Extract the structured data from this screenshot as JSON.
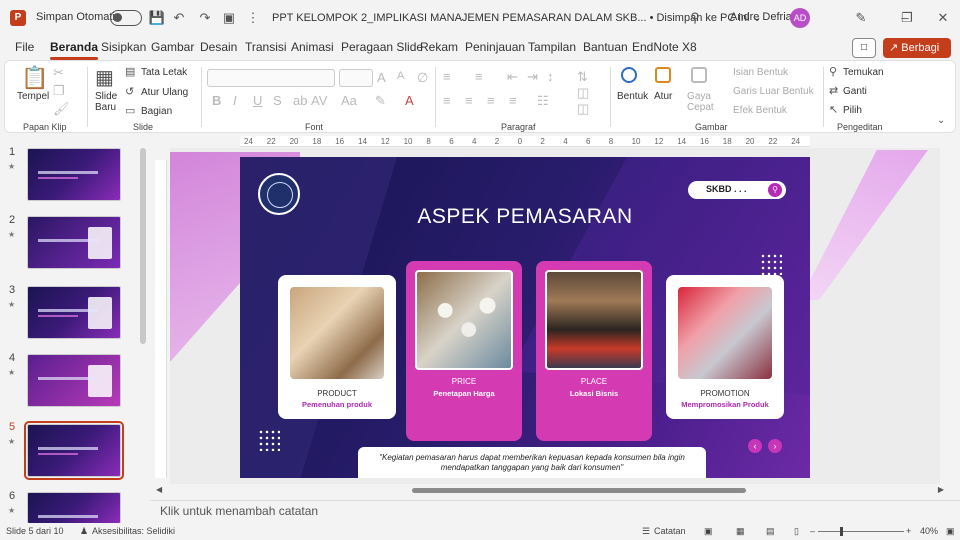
{
  "titlebar": {
    "autosave_label": "Simpan Otomatis",
    "doc_title": "PPT KELOMPOK 2_IMPLIKASI MANAJEMEN PEMASARAN DALAM SKB... • Disimpan ke PC ini ⌄",
    "user_name": "Andre Defrian",
    "user_initials": "AD"
  },
  "tabs": [
    "File",
    "Beranda",
    "Sisipkan",
    "Gambar",
    "Desain",
    "Transisi",
    "Animasi",
    "Peragaan Slide",
    "Rekam",
    "Peninjauan",
    "Tampilan",
    "Bantuan",
    "EndNote X8"
  ],
  "share_label": "Berbagi",
  "ribbon": {
    "paste": "Tempel",
    "new_slide": "Slide Baru",
    "layout": "Tata Letak",
    "reset": "Atur Ulang",
    "section": "Bagian",
    "shapes": "Bentuk",
    "arrange": "Atur",
    "quick_styles": "Gaya Cepat",
    "shape_fill": "Isian Bentuk",
    "shape_outline": "Garis Luar Bentuk",
    "shape_effects": "Efek Bentuk",
    "find": "Temukan",
    "replace": "Ganti",
    "select": "Pilih",
    "groups": {
      "clipboard": "Papan Klip",
      "slides": "Slide",
      "font": "Font",
      "paragraph": "Paragraf",
      "drawing": "Gambar",
      "editing": "Pengeditan"
    }
  },
  "thumbnails": [
    {
      "num": "1"
    },
    {
      "num": "2"
    },
    {
      "num": "3"
    },
    {
      "num": "4"
    },
    {
      "num": "5"
    },
    {
      "num": "6"
    }
  ],
  "ruler_ticks": [
    "24",
    "22",
    "20",
    "18",
    "16",
    "14",
    "12",
    "10",
    "8",
    "6",
    "4",
    "2",
    "0",
    "2",
    "4",
    "6",
    "8",
    "10",
    "12",
    "14",
    "16",
    "18",
    "20",
    "22",
    "24"
  ],
  "slide": {
    "search_text": "SKBD . . .",
    "title": "ASPEK PEMASARAN",
    "cards": [
      {
        "title": "PRODUCT",
        "subtitle": "Pemenuhan produk"
      },
      {
        "title": "PRICE",
        "subtitle": "Penetapan Harga"
      },
      {
        "title": "PLACE",
        "subtitle": "Lokasi Bisnis"
      },
      {
        "title": "PROMOTION",
        "subtitle": "Mempromosikan Produk"
      }
    ],
    "quote": "\"Kegiatan pemasaran harus dapat memberikan kepuasan kepada konsumen bila ingin mendapatkan tanggapan yang baik dari konsumen\""
  },
  "notes_placeholder": "Klik untuk menambah catatan",
  "status": {
    "slide_counter": "Slide 5 dari 10",
    "accessibility": "Aksesibilitas: Selidiki",
    "notes_btn": "Catatan",
    "zoom": "40%"
  },
  "colors": {
    "accent": "#c43e1c",
    "slide_bg": "#1b1452",
    "magenta": "#d43bb3"
  }
}
